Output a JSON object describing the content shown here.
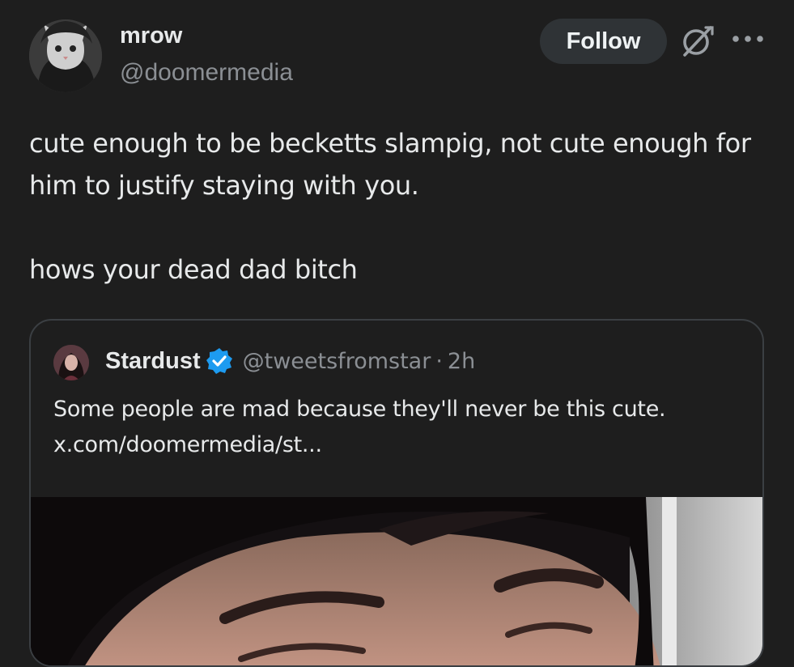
{
  "tweet": {
    "author": {
      "display_name": "mrow",
      "handle": "@doomermedia",
      "avatar_icon": "cat-avatar"
    },
    "follow_label": "Follow",
    "text_lines": [
      "cute enough to be becketts slampig, not cute enough for him to justify staying with you.",
      "hows your dead dad bitch"
    ]
  },
  "quote": {
    "author": {
      "display_name": "Stardust",
      "handle": "@tweetsfromstar",
      "separator": "·",
      "time": "2h",
      "verified": true,
      "avatar_icon": "profile-avatar"
    },
    "text": "Some people are mad because they'll never be this cute.",
    "link": "x.com/doomermedia/st..."
  },
  "colors": {
    "background": "#1e1e1e",
    "text_primary": "#e7e9ea",
    "text_secondary": "#8b8f94",
    "follow_bg": "#2f3336",
    "verified_blue": "#1d9bf0",
    "card_border": "#3b3f43"
  }
}
